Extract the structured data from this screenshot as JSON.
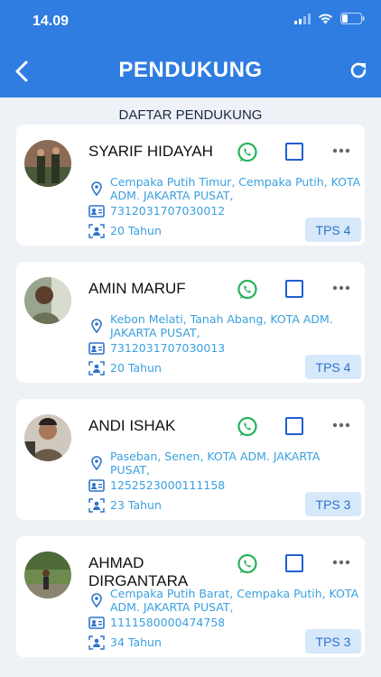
{
  "status": {
    "time": "14.09"
  },
  "header": {
    "title": "PENDUKUNG"
  },
  "section": {
    "title": "DAFTAR PENDUKUNG"
  },
  "colors": {
    "primary": "#2f7de1",
    "accent_text": "#3aa0df",
    "whatsapp": "#25b35a",
    "badge_bg": "#d7e8fb"
  },
  "icons": {
    "back": "back-arrow-icon",
    "refresh": "refresh-icon",
    "whatsapp": "whatsapp-icon",
    "more": "more-dots-icon",
    "location": "location-pin-icon",
    "id": "id-card-icon",
    "age": "person-scan-icon"
  },
  "supporters": [
    {
      "name": "SYARIF HIDAYAH",
      "address": "Cempaka Putih Timur, Cempaka Putih, KOTA ADM. JAKARTA PUSAT,",
      "nik": "7312031707030012",
      "age": "20 Tahun",
      "tps": "TPS 4"
    },
    {
      "name": "AMIN MARUF",
      "address": "Kebon Melati, Tanah Abang, KOTA ADM. JAKARTA PUSAT,",
      "nik": "7312031707030013",
      "age": "20 Tahun",
      "tps": "TPS 4"
    },
    {
      "name": "ANDI ISHAK",
      "address": "Paseban, Senen, KOTA ADM. JAKARTA PUSAT,",
      "nik": "1252523000111158",
      "age": "23 Tahun",
      "tps": "TPS 3"
    },
    {
      "name": "AHMAD DIRGANTARA",
      "address": "Cempaka Putih Barat, Cempaka Putih, KOTA ADM. JAKARTA PUSAT,",
      "nik": "1111580000474758",
      "age": "34 Tahun",
      "tps": "TPS 3"
    }
  ]
}
